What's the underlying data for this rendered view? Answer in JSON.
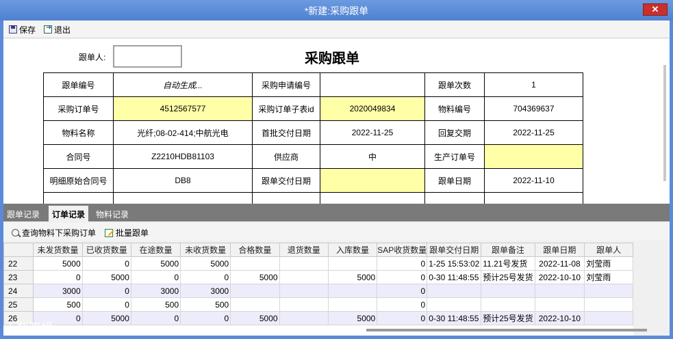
{
  "window": {
    "title": "*新建:采购跟单",
    "close_glyph": "✕"
  },
  "toolbar": {
    "save_label": "保存",
    "exit_label": "退出"
  },
  "form": {
    "follower_label": "跟单人:",
    "follower_value": "",
    "doc_title": "采购跟单",
    "rows": [
      [
        "跟单编号",
        "自动生成...",
        "采购申请编号",
        "",
        "跟单次数",
        "1"
      ],
      [
        "采购订单号",
        "4512567577",
        "采购订单子表id",
        "2020049834",
        "物料编号",
        "704369637"
      ],
      [
        "物料名称",
        "光纤;08-02-414;中航光电",
        "首批交付日期",
        "2022-11-25",
        "回复交期",
        "2022-11-25"
      ],
      [
        "合同号",
        "Z2210HDB81103",
        "供应商",
        "中",
        "生产订单号",
        ""
      ],
      [
        "明细原始合同号",
        "DB8",
        "跟单交付日期",
        "",
        "跟单日期",
        "2022-11-10"
      ]
    ]
  },
  "tabs": [
    "跟单记录",
    "订单记录",
    "物料记录"
  ],
  "active_tab": 1,
  "subtoolbar": {
    "query_label": "查询物料下采购订单",
    "batch_label": "批量跟单"
  },
  "grid": {
    "columns": [
      "未发货数量",
      "已收货数量",
      "在途数量",
      "未收货数量",
      "合格数量",
      "退货数量",
      "入库数量",
      "SAP收货数量",
      "跟单交付日期",
      "跟单备注",
      "跟单日期",
      "跟单人"
    ],
    "rows": [
      {
        "n": "22",
        "cells": [
          "5000",
          "0",
          "5000",
          "5000",
          "",
          "",
          "",
          "0",
          "1-25 15:53:02",
          "11.21号发货",
          "2022-11-08",
          "刘莹雨"
        ]
      },
      {
        "n": "23",
        "cells": [
          "0",
          "5000",
          "0",
          "0",
          "5000",
          "",
          "5000",
          "0",
          "0-30 11:48:55",
          "预计25号发货",
          "2022-10-10",
          "刘莹雨"
        ]
      },
      {
        "n": "24",
        "cells": [
          "3000",
          "0",
          "3000",
          "3000",
          "",
          "",
          "",
          "0",
          "",
          "",
          "",
          ""
        ]
      },
      {
        "n": "25",
        "cells": [
          "500",
          "0",
          "500",
          "500",
          "",
          "",
          "",
          "0",
          "",
          "",
          "",
          ""
        ]
      },
      {
        "n": "26",
        "cells": [
          "0",
          "5000",
          "0",
          "0",
          "5000",
          "",
          "5000",
          "0",
          "0-30 11:48:55",
          "预计25号发货",
          "2022-10-10",
          ""
        ]
      }
    ]
  },
  "watermark": "大数跨境"
}
